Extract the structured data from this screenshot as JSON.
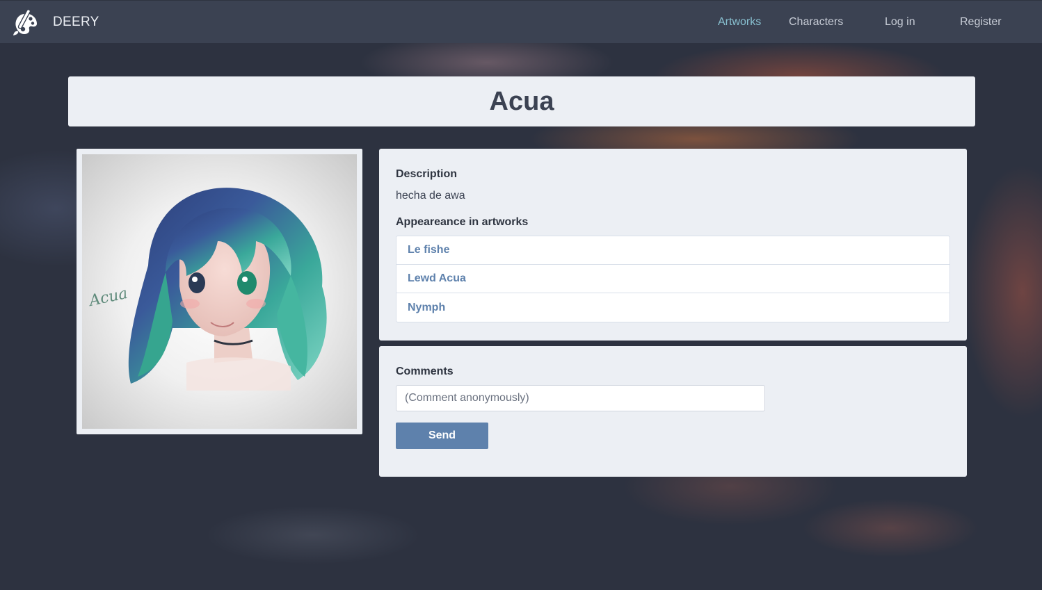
{
  "navbar": {
    "brand": "DEERY",
    "links": [
      {
        "label": "Artworks",
        "active": true
      },
      {
        "label": "Characters",
        "active": false
      },
      {
        "label": "Log in",
        "active": false
      },
      {
        "label": "Register",
        "active": false
      }
    ]
  },
  "character": {
    "name": "Acua",
    "image_signature": "Acua",
    "description_label": "Description",
    "description": "hecha de awa",
    "appearances_label": "Appeareance in artworks",
    "appearances": [
      "Le fishe",
      "Lewd Acua",
      "Nymph"
    ]
  },
  "comments": {
    "label": "Comments",
    "placeholder": "(Comment anonymously)",
    "value": "",
    "send_label": "Send"
  },
  "colors": {
    "navbar_bg": "#3b4252",
    "card_bg": "#eceff4",
    "accent": "#5e81ac",
    "active_link": "#88c0d0",
    "page_bg": "#2d3240"
  },
  "icons": {
    "brand": "paint-palette-brush-icon"
  }
}
